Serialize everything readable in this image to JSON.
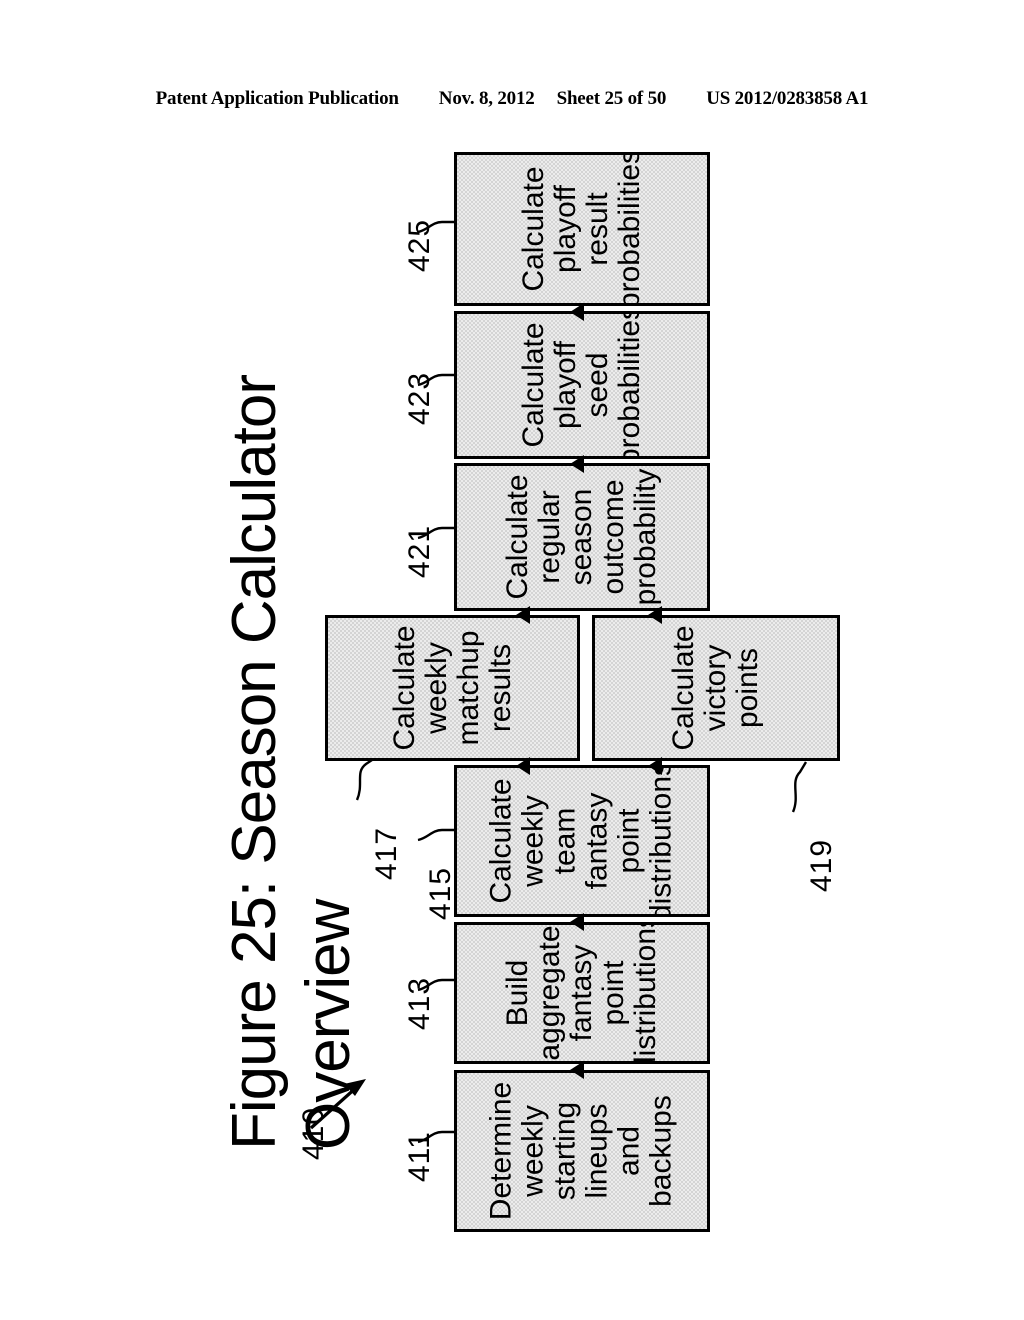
{
  "header": {
    "publication": "Patent Application Publication",
    "date": "Nov. 8, 2012",
    "sheet": "Sheet 25 of 50",
    "patent_number": "US 2012/0283858 A1"
  },
  "figure": {
    "title_line1": "Figure 25: Season Calculator",
    "title_line2": "Overview",
    "diagram_label": "410",
    "fill_color": "#d4d4d4",
    "line_color": "#000000"
  },
  "boxes": [
    {
      "ref": "411",
      "lines": [
        "Determine",
        "weekly",
        "starting",
        "lineups",
        "and",
        "backups"
      ]
    },
    {
      "ref": "413",
      "lines": [
        "Build",
        "aggregate",
        "fantasy",
        "point",
        "distributions"
      ]
    },
    {
      "ref": "415",
      "lines": [
        "Calculate",
        "weekly",
        "team",
        "fantasy",
        "point",
        "distributions"
      ]
    },
    {
      "ref": "417",
      "lines": [
        "Calculate",
        "weekly",
        "matchup",
        "results"
      ]
    },
    {
      "ref": "419",
      "lines": [
        "Calculate",
        "victory",
        "points"
      ]
    },
    {
      "ref": "421",
      "lines": [
        "Calculate",
        "regular",
        "season",
        "outcome",
        "probability"
      ]
    },
    {
      "ref": "423",
      "lines": [
        "Calculate",
        "playoff",
        "seed",
        "probabilities"
      ]
    },
    {
      "ref": "425",
      "lines": [
        "Calculate",
        "playoff",
        "result",
        "probabilities"
      ]
    }
  ]
}
